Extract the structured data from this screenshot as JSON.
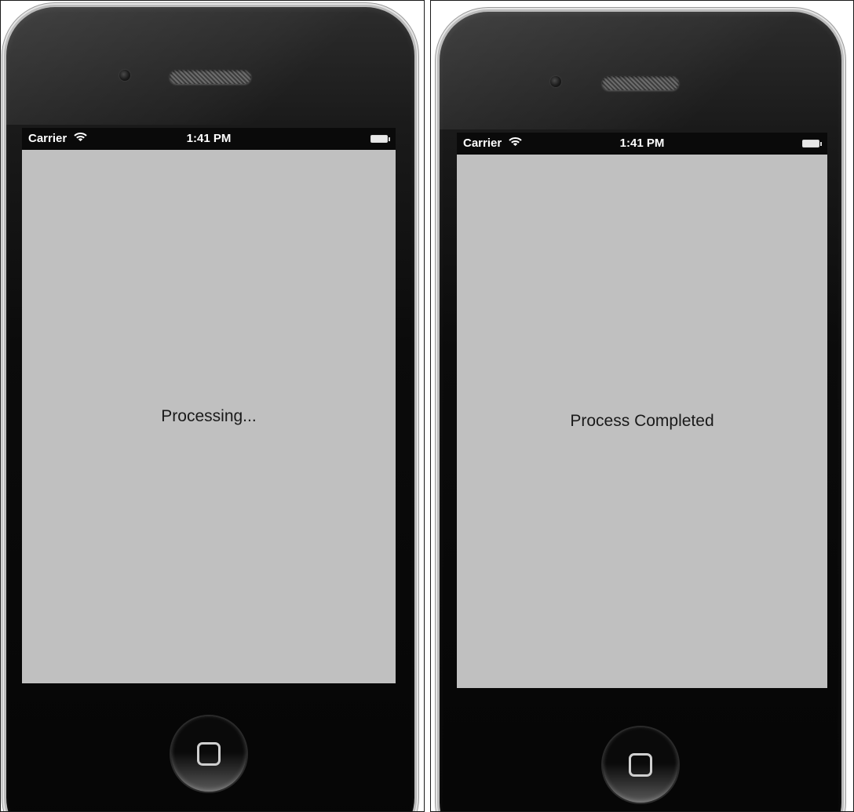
{
  "screens": [
    {
      "status_bar": {
        "carrier": "Carrier",
        "time": "1:41 PM"
      },
      "label": "Processing..."
    },
    {
      "status_bar": {
        "carrier": "Carrier",
        "time": "1:41 PM"
      },
      "label": "Process Completed"
    }
  ],
  "icons": {
    "wifi": "wifi-icon",
    "battery": "battery-icon",
    "home": "home-button-icon"
  },
  "colors": {
    "screen_background": "#c0c0c0",
    "status_bar": "#0a0a0a",
    "device_body": "#0a0a0a"
  }
}
